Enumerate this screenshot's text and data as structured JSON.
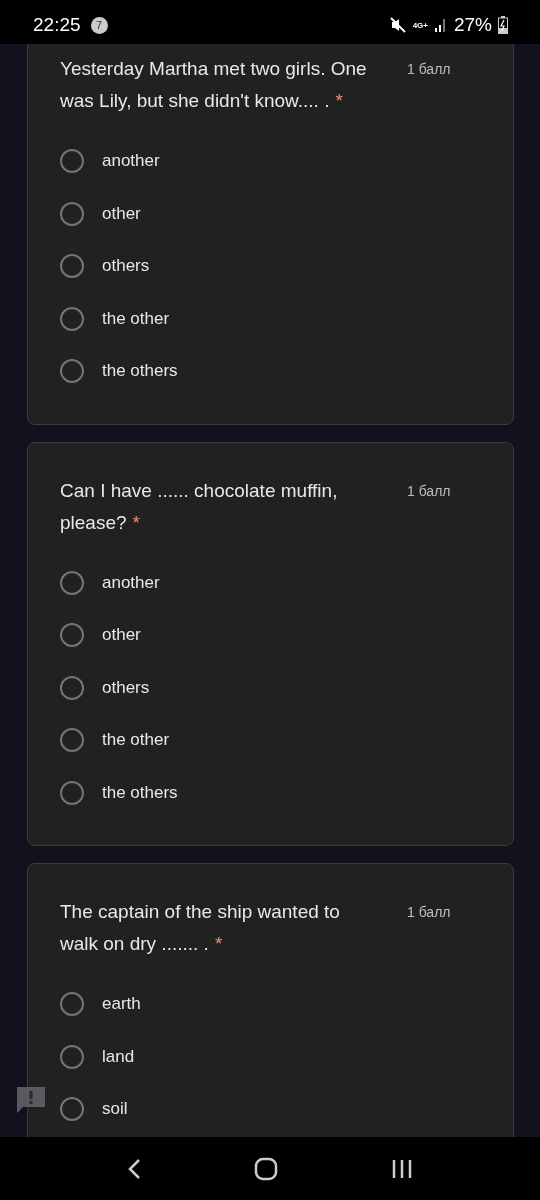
{
  "status_bar": {
    "time": "22:25",
    "notification_count": "7",
    "network": "4G+",
    "battery": "27%"
  },
  "questions": [
    {
      "text": "Yesterday Martha met two girls. One was Lily, but she didn't know.... .",
      "required_mark": "*",
      "points": "1 балл",
      "options": [
        {
          "label": "another",
          "selected": false
        },
        {
          "label": "other",
          "selected": false
        },
        {
          "label": "others",
          "selected": false
        },
        {
          "label": "the other",
          "selected": false
        },
        {
          "label": "the others",
          "selected": false
        }
      ]
    },
    {
      "text": "Can I have ...... chocolate muffin, please?",
      "required_mark": "*",
      "points": "1 балл",
      "options": [
        {
          "label": "another",
          "selected": false
        },
        {
          "label": "other",
          "selected": false
        },
        {
          "label": "others",
          "selected": false
        },
        {
          "label": "the other",
          "selected": false
        },
        {
          "label": "the others",
          "selected": false
        }
      ]
    },
    {
      "text": "The captain of the ship wanted to walk on dry ....... .",
      "required_mark": "*",
      "points": "1 балл",
      "options": [
        {
          "label": "earth",
          "selected": false
        },
        {
          "label": "land",
          "selected": false
        },
        {
          "label": "soil",
          "selected": false
        }
      ]
    }
  ]
}
